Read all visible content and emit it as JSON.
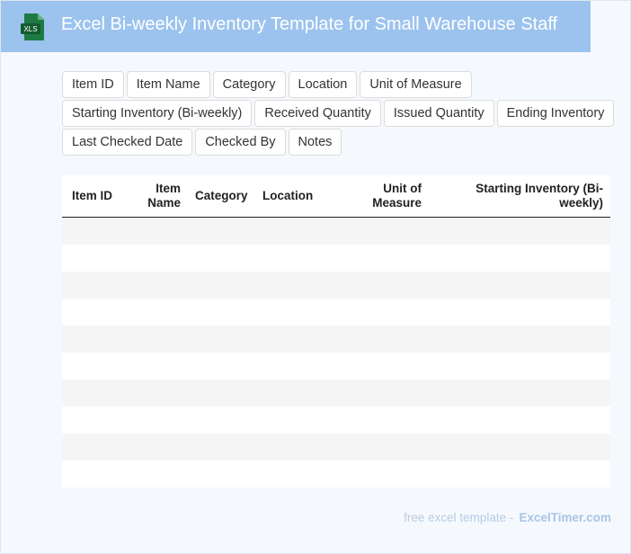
{
  "header": {
    "title": "Excel Bi-weekly Inventory Template for Small Warehouse Staff",
    "icon": "xls-file-icon",
    "icon_label": "XLS",
    "background_color": "#9cc3ee"
  },
  "field_chips": [
    [
      "Item ID",
      "Item Name",
      "Category",
      "Location",
      "Unit of Measure"
    ],
    [
      "Starting Inventory (Bi-weekly)",
      "Received Quantity",
      "Issued Quantity",
      "Ending Inventory"
    ],
    [
      "Last Checked Date",
      "Checked By",
      "Notes"
    ]
  ],
  "table": {
    "columns": [
      "Item ID",
      "Item Name",
      "Category",
      "Location",
      "Unit of Measure",
      "Starting Inventory (Bi-weekly)"
    ],
    "row_count": 10
  },
  "footer": {
    "prefix": "free excel template -",
    "brand": "ExcelTimer.com"
  }
}
